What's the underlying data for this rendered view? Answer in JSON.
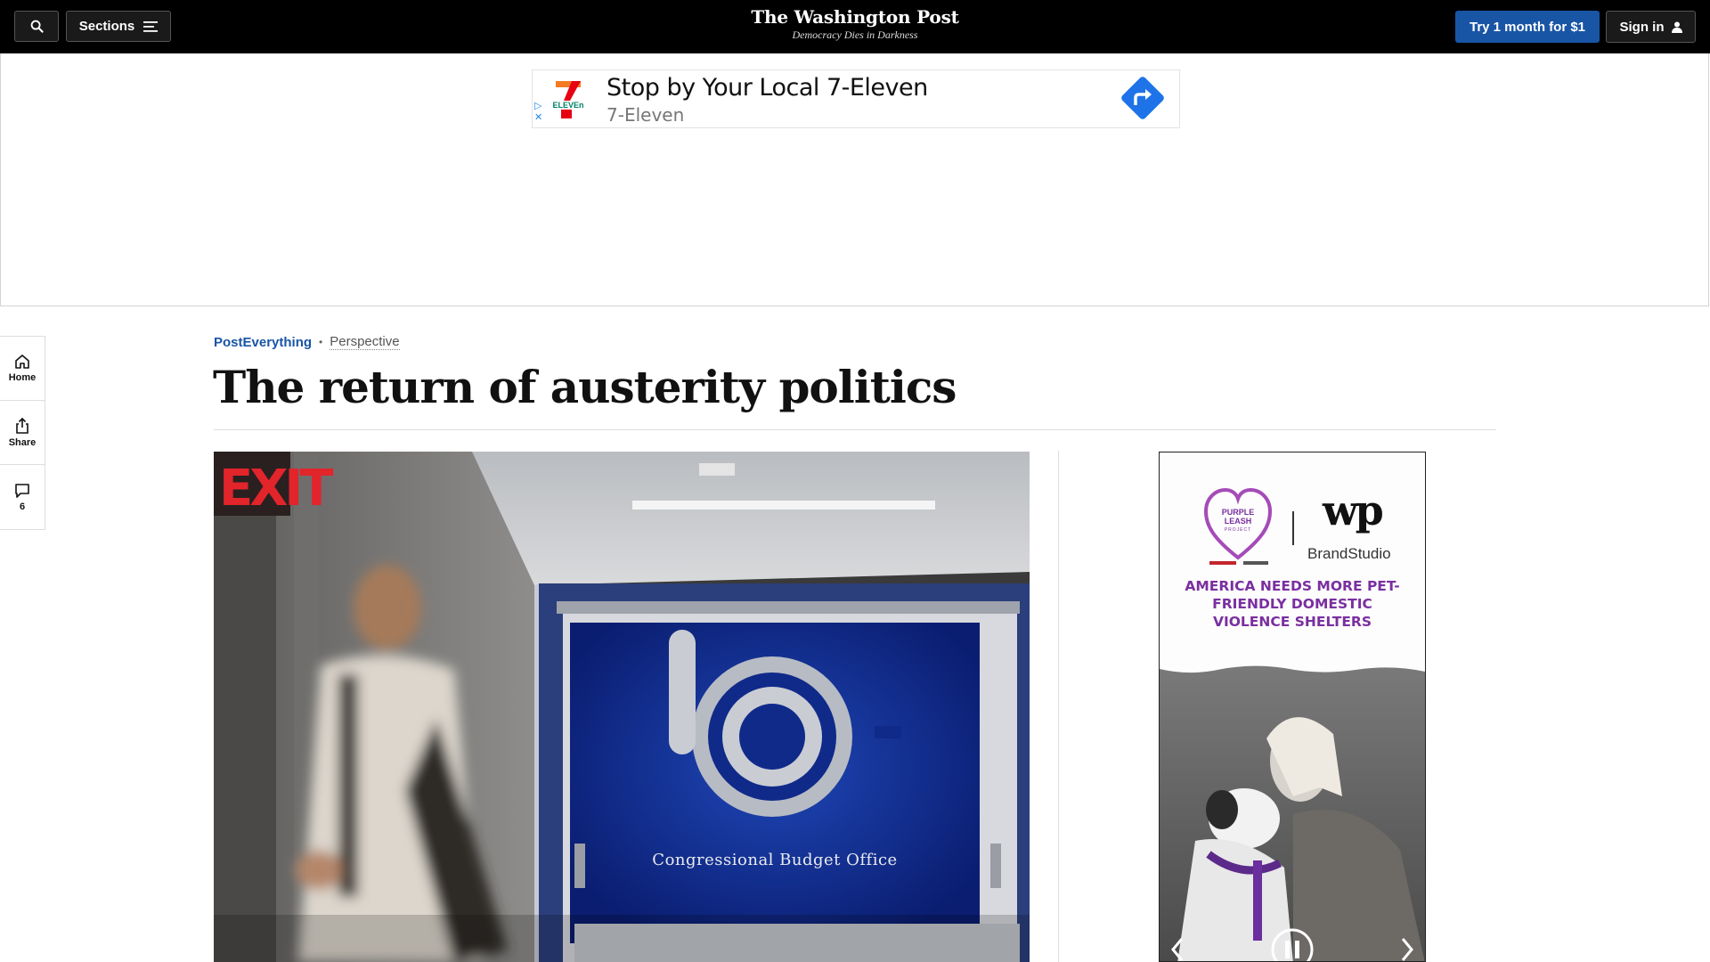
{
  "header": {
    "search_icon": "search-icon",
    "sections_label": "Sections",
    "logo_title": "The Washington Post",
    "logo_tagline": "Democracy Dies in Darkness",
    "subscribe_label": "Try 1 month for $1",
    "signin_label": "Sign in"
  },
  "top_ad": {
    "headline": "Stop by Your Local 7-Eleven",
    "advertiser": "7-Eleven",
    "logo_text": "ELEVEn"
  },
  "rail": {
    "items": [
      {
        "label": "Home",
        "icon": "home-icon"
      },
      {
        "label": "Share",
        "icon": "share-icon"
      },
      {
        "label": "6",
        "icon": "comment-icon"
      }
    ]
  },
  "article": {
    "section": "PostEverything",
    "label": "Perspective",
    "headline": "The return of austerity politics",
    "photo": {
      "exit_sign": "EXIT",
      "wall_sign": "Congressional Budget Office"
    }
  },
  "side_ad": {
    "brand": "BrandStudio",
    "wp_mark": "wp",
    "partner_line1": "PURPLE",
    "partner_line2": "LEASH",
    "partner_line3": "PROJECT",
    "message": "AMERICA NEEDS MORE PET-FRIENDLY DOMESTIC VIOLENCE SHELTERS"
  },
  "colors": {
    "topbar": "#000000",
    "subscribe": "#1955a5",
    "section_link": "#1955a5",
    "ad_purple": "#7a2fa0",
    "seven_red": "#e60012",
    "seven_orange": "#f47b20",
    "seven_green": "#008163",
    "arrow_blue": "#1e73e8"
  }
}
